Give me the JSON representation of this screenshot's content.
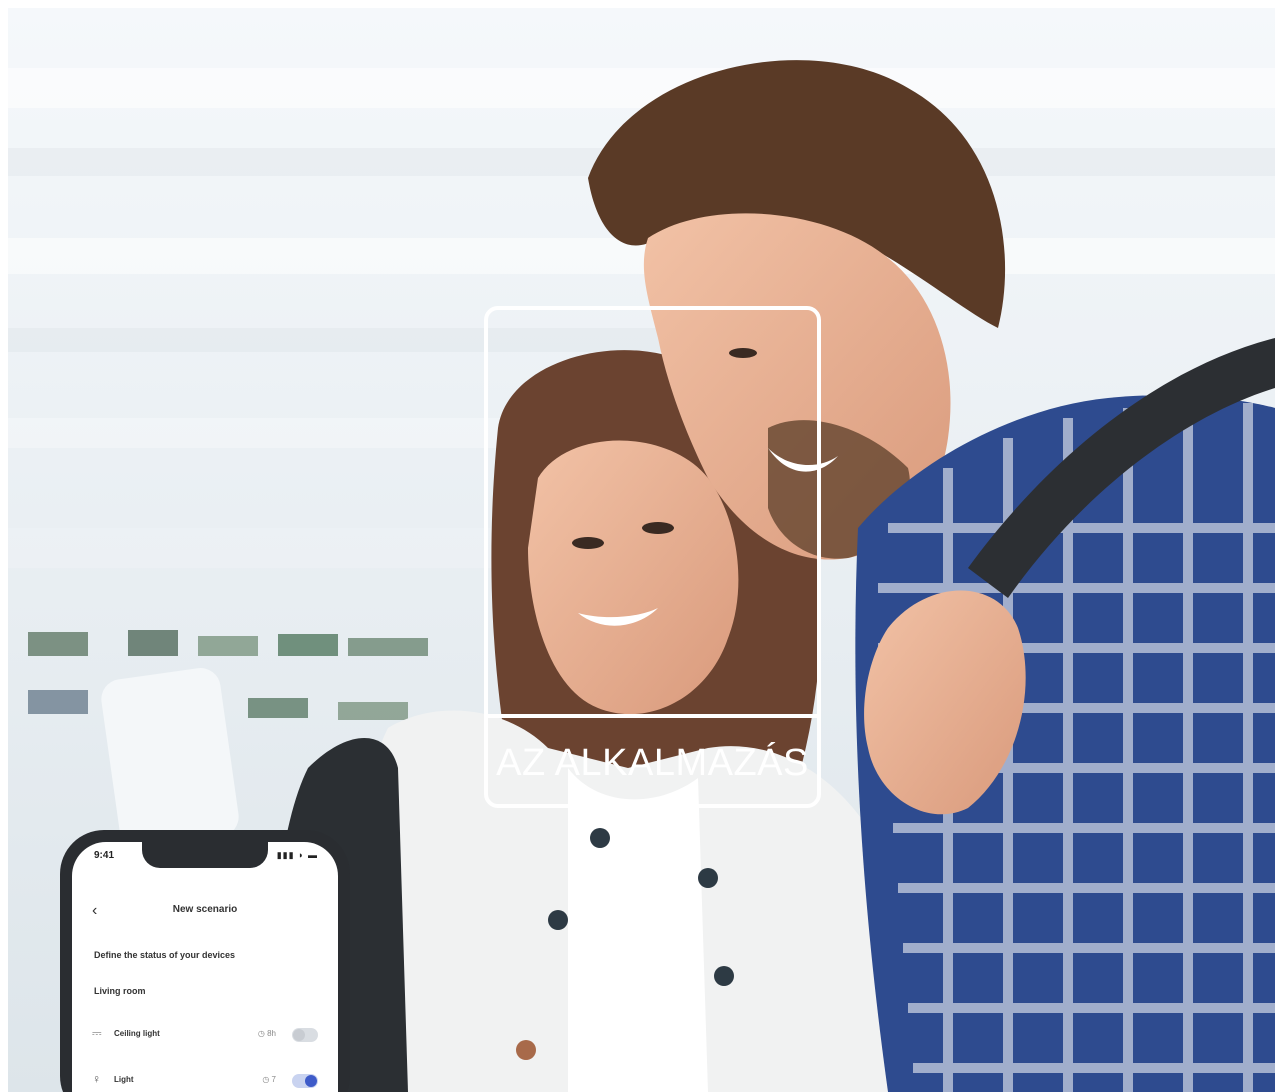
{
  "overlay": {
    "title": "AZ ALKALMAZÁS"
  },
  "phone": {
    "status_time": "9:41",
    "status_icons": "▮▮▮ ◗ ▬",
    "back_glyph": "‹",
    "title": "New scenario",
    "subtitle": "Define the status of your devices",
    "room": "Living room",
    "devices": [
      {
        "name": "Ceiling light",
        "state": "◷ 8h",
        "toggle": "off"
      },
      {
        "name": "Light",
        "state": "◷ 7",
        "toggle": "on"
      }
    ]
  },
  "colors": {
    "accent": "#3e5bc9",
    "frame": "#ffffff"
  },
  "icons": [
    "ceiling-light-icon",
    "bulb-icon",
    "back-icon"
  ]
}
